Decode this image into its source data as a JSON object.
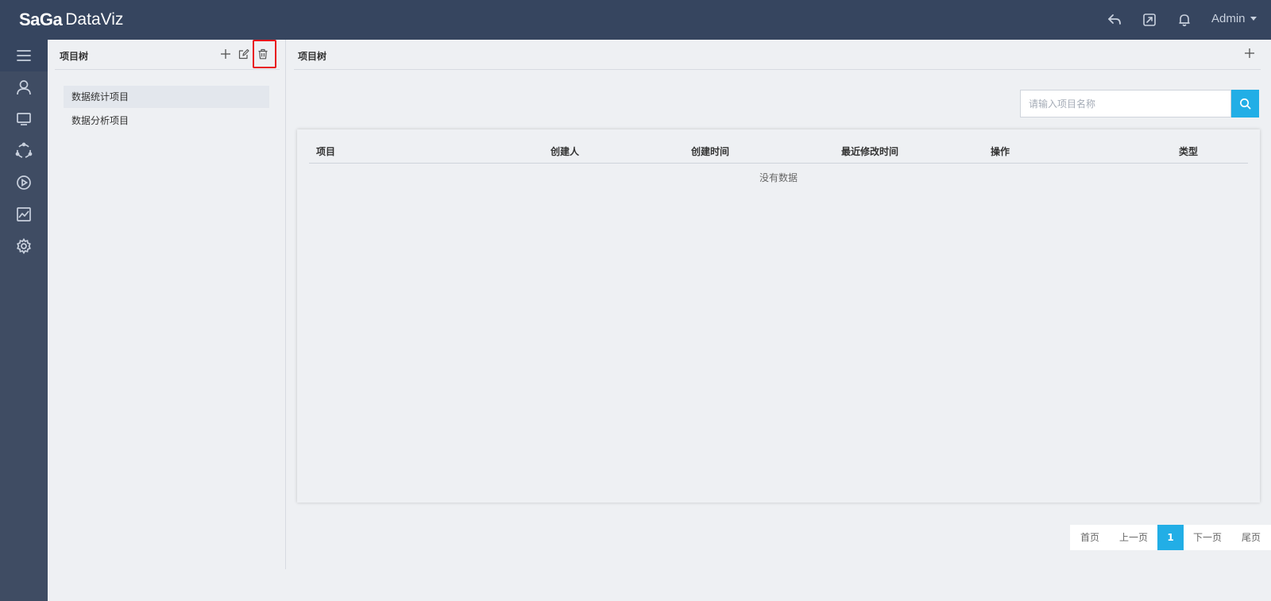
{
  "header": {
    "brand": "SaGa",
    "product": "DataViz",
    "user": "Admin",
    "icons": [
      "reply-icon",
      "external-edit-icon",
      "bell-icon"
    ]
  },
  "rail": {
    "items": [
      "menu-icon",
      "user-icon",
      "monitor-icon",
      "cycle-icon",
      "play-circle-icon",
      "line-chart-icon",
      "gear-icon"
    ]
  },
  "tree": {
    "title": "项目树",
    "items": [
      "数据统计项目",
      "数据分析项目"
    ],
    "selected_index": 0
  },
  "main": {
    "title": "项目树",
    "search_placeholder": "请输入项目名称",
    "table": {
      "columns": [
        "项目",
        "创建人",
        "创建时间",
        "最近修改时间",
        "操作",
        "类型"
      ],
      "rows": [],
      "empty_text": "没有数据"
    },
    "pagination": {
      "first": "首页",
      "prev": "上一页",
      "current": "1",
      "next": "下一页",
      "last": "尾页"
    }
  },
  "colors": {
    "topbar": "#36455f",
    "rail": "#3f4c63",
    "accent": "#22aee6",
    "highlight": "#e8141c"
  }
}
